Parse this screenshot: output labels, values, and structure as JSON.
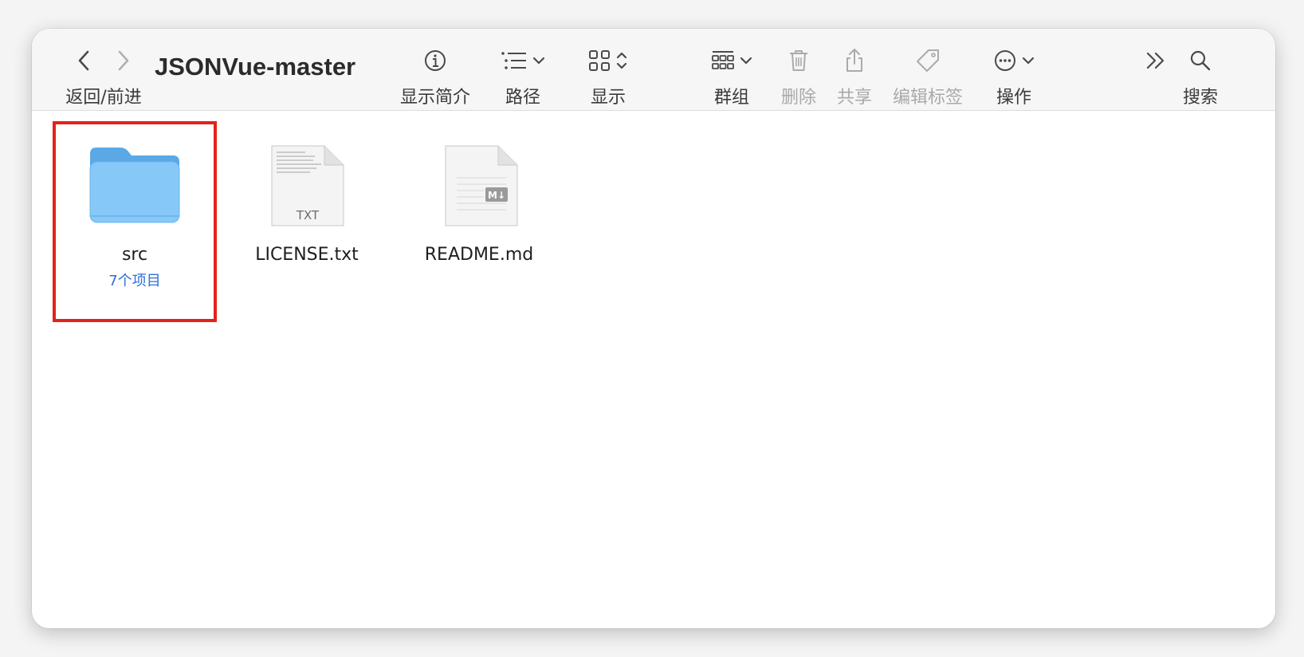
{
  "window": {
    "title": "JSONVue-master"
  },
  "toolbar": {
    "nav_label": "返回/前进",
    "info_label": "显示简介",
    "path_label": "路径",
    "view_label": "显示",
    "group_label": "群组",
    "delete_label": "删除",
    "share_label": "共享",
    "tags_label": "编辑标签",
    "action_label": "操作",
    "search_label": "搜索"
  },
  "files": [
    {
      "name": "src",
      "subtitle": "7个项目",
      "icon": "folder-icon"
    },
    {
      "name": "LICENSE.txt",
      "badge": "TXT",
      "icon": "txt-file-icon"
    },
    {
      "name": "README.md",
      "badge": "M↓",
      "icon": "markdown-file-icon"
    }
  ],
  "colors": {
    "folder": "#7cc3f5",
    "folder_tab": "#5aa9e6",
    "highlight": "#e2231a",
    "subtitle": "#2f6fd6"
  }
}
